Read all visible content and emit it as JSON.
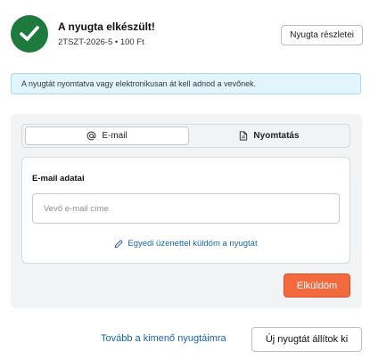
{
  "header": {
    "title": "A nyugta elkészült!",
    "subtitle": "2TSZT-2026-5 • 100 Ft",
    "details_button": "Nyugta részletei",
    "status_icon": "checkmark-icon",
    "status_color": "#1e7a3c"
  },
  "info_banner": {
    "text": "A nyugtát nyomtatva vagy elektronikusan át kell adnod a vevőnek."
  },
  "tabs": [
    {
      "label": "E-mail",
      "icon": "at-sign-icon",
      "active": true
    },
    {
      "label": "Nyomtatás",
      "icon": "document-icon",
      "active": false
    }
  ],
  "email_card": {
    "title": "E-mail adatai",
    "input_placeholder": "Vevő e-mail címe",
    "input_value": "",
    "custom_message_link": "Egyedi üzenettel küldöm a nyugtát",
    "link_icon": "pencil-icon"
  },
  "send_button": {
    "label": "Elküldöm",
    "color": "#f26a3d"
  },
  "footer": {
    "outgoing_link": "Tovább a kimenő nyugtáimra",
    "new_receipt_button": "Új nyugtát állítok ki"
  }
}
